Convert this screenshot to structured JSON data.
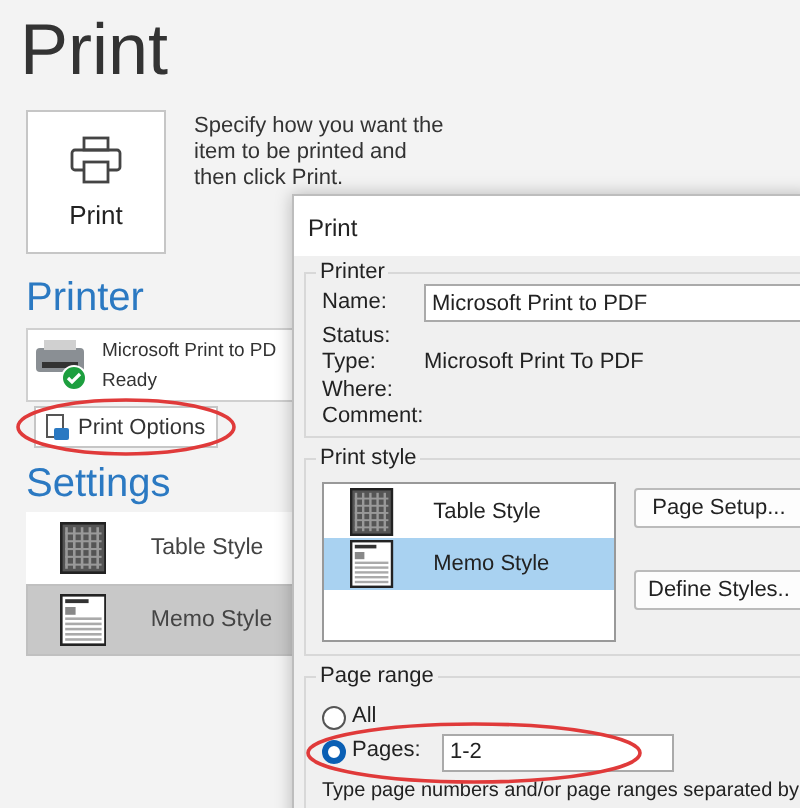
{
  "page": {
    "title": "Print",
    "print_button": "Print",
    "description": "Specify how you want the item to be printed and then click Print.",
    "printer_heading": "Printer",
    "printer": {
      "name": "Microsoft Print to PD",
      "status": "Ready"
    },
    "print_options": {
      "label": "Print Options",
      "highlighted": true
    },
    "settings_heading": "Settings",
    "styles": [
      {
        "label": "Table Style",
        "kind": "table",
        "selected": false
      },
      {
        "label": "Memo Style",
        "kind": "memo",
        "selected": true
      }
    ]
  },
  "dialog": {
    "title": "Print",
    "printer_group": {
      "label": "Printer",
      "name_label": "Name:",
      "name_value": "Microsoft Print to PDF",
      "fields": [
        {
          "label": "Status:"
        },
        {
          "label": "Type:",
          "value": "Microsoft Print To PDF"
        },
        {
          "label": "Where:"
        },
        {
          "label": "Comment:"
        }
      ]
    },
    "style_group": {
      "label": "Print style",
      "styles": [
        {
          "label": "Table Style",
          "kind": "table",
          "selected": false
        },
        {
          "label": "Memo Style",
          "kind": "memo",
          "selected": true
        }
      ],
      "buttons": [
        "Page Setup...",
        "Define Styles.."
      ]
    },
    "range_group": {
      "label": "Page range",
      "options": [
        {
          "label": "All",
          "selected": false,
          "highlighted": false
        },
        {
          "label": "Pages:",
          "selected": true,
          "highlighted": true
        }
      ],
      "pages_value": "1-2",
      "help": "Type page numbers and/or page ranges separated by"
    }
  }
}
